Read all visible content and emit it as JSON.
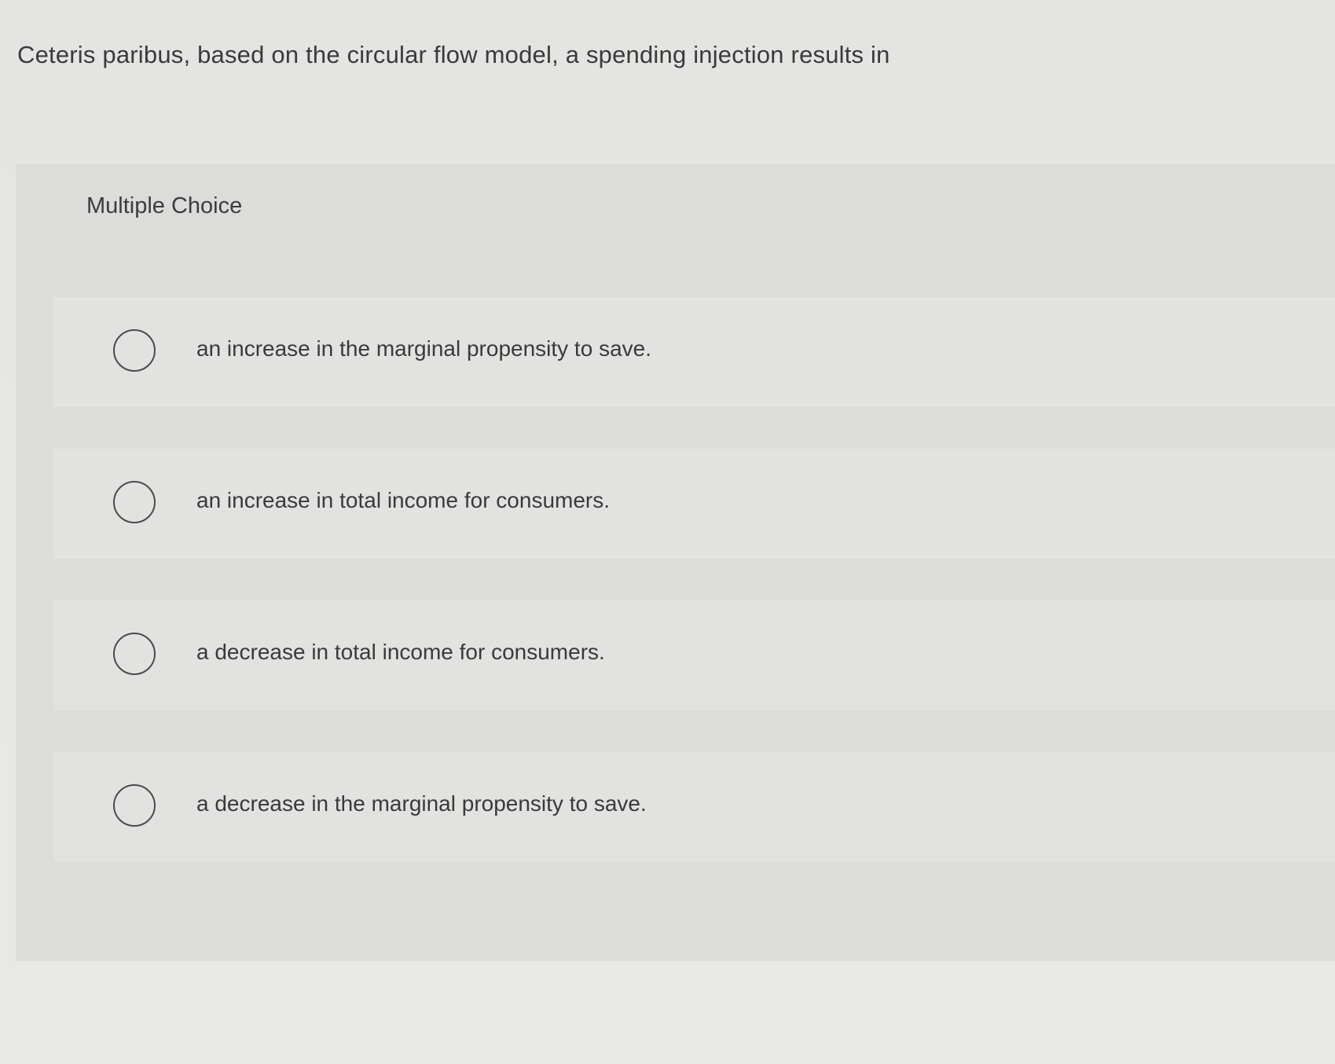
{
  "question": {
    "text": "Ceteris paribus, based on the circular flow model, a spending injection results in"
  },
  "multiple_choice": {
    "label": "Multiple Choice",
    "options": [
      {
        "text": "an increase in the marginal propensity to save.",
        "selected": false
      },
      {
        "text": "an increase in total income for consumers.",
        "selected": false
      },
      {
        "text": "a decrease in total income for consumers.",
        "selected": false
      },
      {
        "text": "a decrease in the marginal propensity to save.",
        "selected": false
      }
    ]
  },
  "colors": {
    "background": "#e6e6e4",
    "panel": "#dcdcda",
    "option_row": "#e2e2e0",
    "text": "#3a3a3a",
    "radio_border": "#4a4a4a"
  }
}
